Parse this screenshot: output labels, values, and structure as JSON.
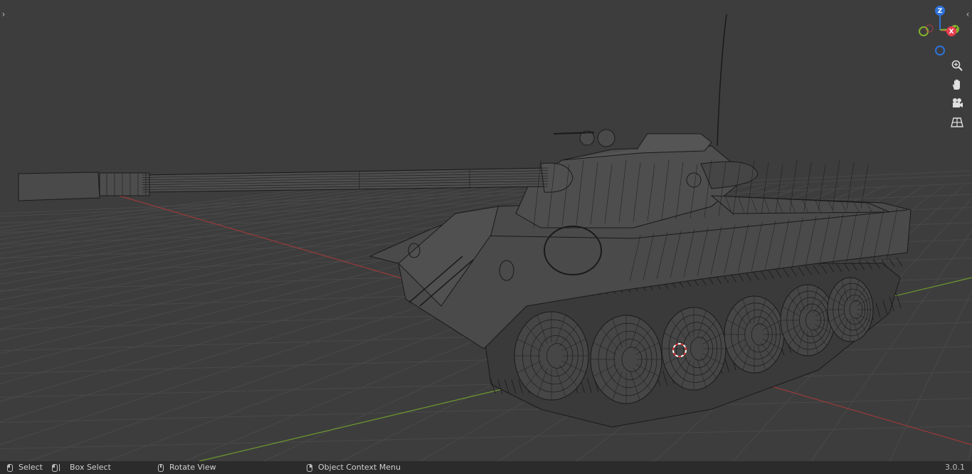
{
  "viewport": {
    "background": "#3d3d3d",
    "grid_color": "#494949",
    "x_axis_color": "#9a3a3a",
    "y_axis_color": "#6f9a2e",
    "wire_color": "#1a1a1a",
    "model_fill": "#474747"
  },
  "gizmo": {
    "z_label": "Z",
    "x_label": "X",
    "y_label": "Y",
    "z_color": "#2f73d9",
    "x_color": "#e63c4f",
    "y_color": "#83b32d"
  },
  "nav_tools": [
    "zoom-icon",
    "hand-icon",
    "camera-icon",
    "grid-perspective-icon"
  ],
  "statusbar": {
    "select": "Select",
    "box_select": "Box Select",
    "rotate_view": "Rotate View",
    "context_menu": "Object Context Menu",
    "version": "3.0.1"
  }
}
